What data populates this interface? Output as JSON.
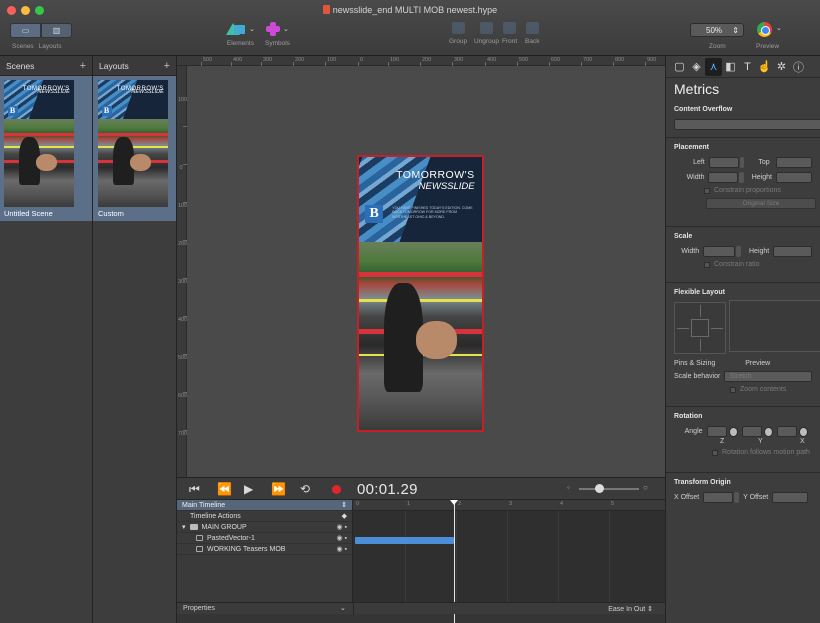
{
  "window": {
    "title": "newsslide_end MULTI MOB newest.hype"
  },
  "toolbar": {
    "scenes_label": "Scenes",
    "layouts_label": "Layouts",
    "elements_label": "Elements",
    "symbols_label": "Symbols",
    "group_label": "Group",
    "ungroup_label": "Ungroup",
    "front_label": "Front",
    "back_label": "Back",
    "zoom_value": "50%",
    "zoom_label": "Zoom",
    "preview_label": "Preview"
  },
  "scenes_pane": {
    "title": "Scenes",
    "add": "+",
    "items": [
      {
        "name": "Untitled Scene"
      }
    ]
  },
  "layouts_pane": {
    "title": "Layouts",
    "add": "+",
    "items": [
      {
        "name": "Custom"
      }
    ]
  },
  "poster": {
    "line1": "TOMORROW'S",
    "line2": "NEWSSLIDE",
    "logo": "B",
    "tagline": "YOU HAVE FINISHED TODAY'S EDITION. COME BACK TOMORROW FOR MORE FROM NORTHEAST OHIO & BEYOND."
  },
  "canvas": {
    "ruler_top": [
      "500",
      "400",
      "300",
      "200",
      "100",
      "0",
      "100",
      "200",
      "300",
      "400",
      "500",
      "600",
      "700",
      "800",
      "900"
    ],
    "ruler_left": [
      "100",
      "0",
      "100",
      "200",
      "300",
      "400",
      "500",
      "600",
      "700",
      "800",
      "900"
    ]
  },
  "timeline": {
    "timecode": "00:01.29",
    "main_timeline": "Main Timeline",
    "timeline_actions": "Timeline Actions",
    "group": "MAIN GROUP",
    "layers": [
      "PastedVector-1",
      "WORKING Teasers  MOB"
    ],
    "ruler": [
      "0",
      "1",
      "2",
      "3",
      "4",
      "5"
    ],
    "properties": "Properties",
    "easing": "Ease In Out"
  },
  "inspector": {
    "title": "Metrics",
    "content_overflow": "Content Overflow",
    "placement": "Placement",
    "left": "Left",
    "top": "Top",
    "width": "Width",
    "height": "Height",
    "constrain_proportions": "Constrain proportions",
    "original_size": "Original Size",
    "scale": "Scale",
    "constrain_ratio": "Constrain ratio",
    "flexible_layout": "Flexible Layout",
    "pins_sizing": "Pins & Sizing",
    "preview": "Preview",
    "scale_behavior": "Scale behavior",
    "stretch": "Stretch",
    "zoom_contents": "Zoom contents",
    "rotation": "Rotation",
    "angle": "Angle",
    "axis_z": "Z",
    "axis_y": "Y",
    "axis_x": "X",
    "rotation_follows": "Rotation follows motion path",
    "transform_origin": "Transform Origin",
    "x_offset": "X Offset",
    "y_offset": "Y Offset"
  },
  "colors": {
    "stage_border": "#c62027",
    "selection": "#5c6f89",
    "record": "#e0262b",
    "clip": "#4a8fd8"
  }
}
